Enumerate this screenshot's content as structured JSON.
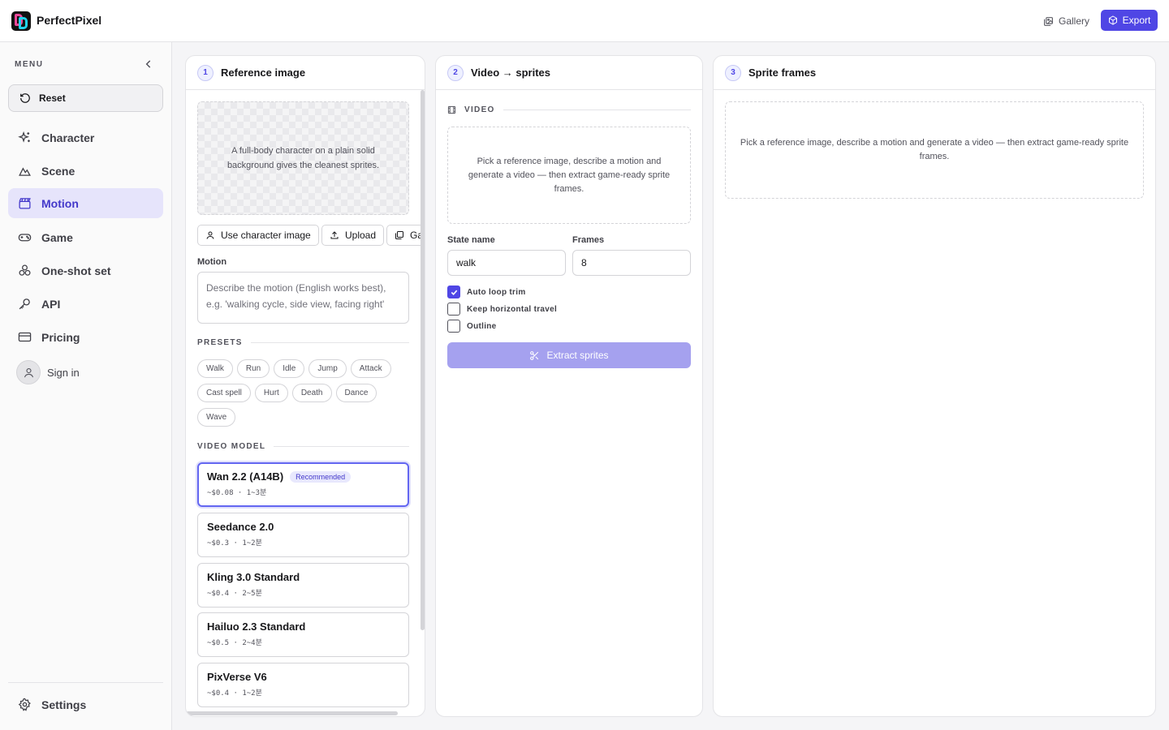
{
  "app": {
    "brand": "PerfectPixel",
    "gallery_label": "Gallery",
    "export_label": "Export"
  },
  "sidebar": {
    "menu_label": "MENU",
    "reset_label": "Reset",
    "items": [
      {
        "label": "Character",
        "icon": "sparkles-icon"
      },
      {
        "label": "Scene",
        "icon": "mountain-icon"
      },
      {
        "label": "Motion",
        "icon": "clapperboard-icon",
        "active": true
      },
      {
        "label": "Game",
        "icon": "gamepad-icon"
      },
      {
        "label": "One-shot set",
        "icon": "shapes-icon"
      },
      {
        "label": "API",
        "icon": "key-icon"
      },
      {
        "label": "Pricing",
        "icon": "credit-card-icon"
      }
    ],
    "signin_label": "Sign in",
    "settings_label": "Settings"
  },
  "panel_reference": {
    "step": "1",
    "title": "Reference image",
    "dropzone_text": "A full-body character on a plain solid background gives the cleanest sprites.",
    "buttons": {
      "use_character": "Use character image",
      "upload": "Upload",
      "gallery": "Gallery"
    },
    "motion_label": "Motion",
    "motion_placeholder": "Describe the motion (English works best), e.g. 'walking cycle, side view, facing right'",
    "presets_title": "PRESETS",
    "presets": [
      "Walk",
      "Run",
      "Idle",
      "Jump",
      "Attack",
      "Cast spell",
      "Hurt",
      "Death",
      "Dance",
      "Wave"
    ],
    "video_model_title": "VIDEO MODEL",
    "models": [
      {
        "name": "Wan 2.2 (A14B)",
        "meta": "~$0.08 · 1~3분",
        "badge": "Recommended",
        "selected": true
      },
      {
        "name": "Seedance 2.0",
        "meta": "~$0.3 · 1~2분"
      },
      {
        "name": "Kling 3.0 Standard",
        "meta": "~$0.4 · 2~5분"
      },
      {
        "name": "Hailuo 2.3 Standard",
        "meta": "~$0.5 · 2~4분"
      },
      {
        "name": "PixVerse V6",
        "meta": "~$0.4 · 1~2분"
      }
    ]
  },
  "panel_video": {
    "step": "2",
    "title": "Video → sprites",
    "video_section": "VIDEO",
    "placeholder_text": "Pick a reference image, describe a motion and generate a video — then extract game-ready sprite frames.",
    "state_name_label": "State name",
    "state_name_value": "walk",
    "frames_label": "Frames",
    "frames_value": "8",
    "options": [
      {
        "label": "Auto loop trim",
        "checked": true
      },
      {
        "label": "Keep horizontal travel",
        "checked": false
      },
      {
        "label": "Outline",
        "checked": false
      }
    ],
    "extract_label": "Extract sprites"
  },
  "panel_frames": {
    "step": "3",
    "title": "Sprite frames",
    "placeholder_text": "Pick a reference image, describe a motion and generate a video — then extract game-ready sprite frames."
  },
  "colors": {
    "accent": "#4f46e5",
    "active_nav_bg": "#e6e4fb"
  }
}
